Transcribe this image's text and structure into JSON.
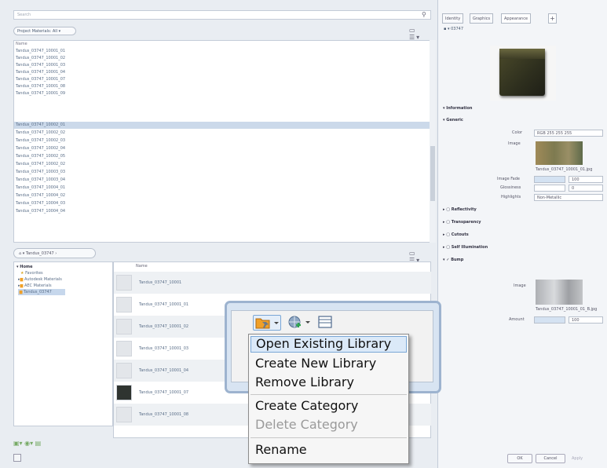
{
  "left": {
    "search_placeholder": "Search",
    "filter_label": "Project Materials: All",
    "list_header": "Name",
    "materials": [
      "Tandus_03747_10001_01",
      "Tandus_03747_10001_02",
      "Tandus_03747_10001_03",
      "Tandus_03747_10001_04",
      "Tandus_03747_10001_07",
      "Tandus_03747_10001_08",
      "Tandus_03747_10001_09",
      "Tandus_03747_10002_01",
      "Tandus_03747_10002_02",
      "Tandus_03747_10002_03",
      "Tandus_03747_10002_04",
      "Tandus_03747_10002_05",
      "Tandus_03747_10002_02",
      "Tandus_03747_10003_03",
      "Tandus_03747_10003_04",
      "Tandus_03747_10004_01",
      "Tandus_03747_10004_02",
      "Tandus_03747_10004_03",
      "Tandus_03747_10004_04"
    ],
    "breadcrumb": "Tandus_03747",
    "tree": {
      "home": "Home",
      "favorites": "Favorites",
      "libraries": [
        "Autodesk Materials",
        "AEC Materials",
        "Tandus_03747"
      ]
    },
    "grid_header": "Name",
    "grid_items": [
      "Tandus_03747_10001",
      "Tandus_03747_10001_01",
      "Tandus_03747_10001_02",
      "Tandus_03747_10001_03",
      "Tandus_03747_10001_04",
      "Tandus_03747_10001_07",
      "Tandus_03747_10001_08"
    ]
  },
  "right": {
    "tabs": [
      "Identity",
      "Graphics",
      "Appearance"
    ],
    "add_tab": "+",
    "asset_name": "03747",
    "sections": {
      "information": "Information",
      "generic": "Generic",
      "reflectivity": "Reflectivity",
      "transparency": "Transparency",
      "cutouts": "Cutouts",
      "self_illumination": "Self Illumination",
      "bump": "Bump"
    },
    "generic": {
      "color_label": "Color",
      "color_value": "RGB 255 255 255",
      "image_label": "Image",
      "image_file": "Tandus_03747_10001_01.jpg",
      "image_fade_label": "Image Fade",
      "image_fade_value": "100",
      "glossiness_label": "Glossiness",
      "glossiness_value": "0",
      "highlights_label": "Highlights",
      "highlights_value": "Non-Metallic"
    },
    "bump": {
      "image_label": "Image",
      "image_file": "Tandus_03747_10001_01_B.jpg",
      "amount_label": "Amount",
      "amount_value": "100"
    },
    "buttons": {
      "ok": "OK",
      "cancel": "Cancel",
      "apply": "Apply"
    }
  },
  "menu": {
    "items": [
      {
        "label": "Open Existing Library",
        "state": "highlighted"
      },
      {
        "label": "Create New Library",
        "state": "enabled"
      },
      {
        "label": "Remove Library",
        "state": "enabled"
      },
      {
        "label": "Create Category",
        "state": "enabled"
      },
      {
        "label": "Delete Category",
        "state": "disabled"
      },
      {
        "label": "Rename",
        "state": "enabled"
      }
    ]
  },
  "colors": {
    "accent": "#7aa7d6",
    "highlight": "#dbe9f8",
    "panel": "#e9edf2",
    "folder": "#f0a028"
  },
  "icons": [
    "search-icon",
    "folder-wrench-icon",
    "globe-add-icon",
    "panel-icon",
    "home-icon",
    "dropdown-arrow-icon"
  ]
}
